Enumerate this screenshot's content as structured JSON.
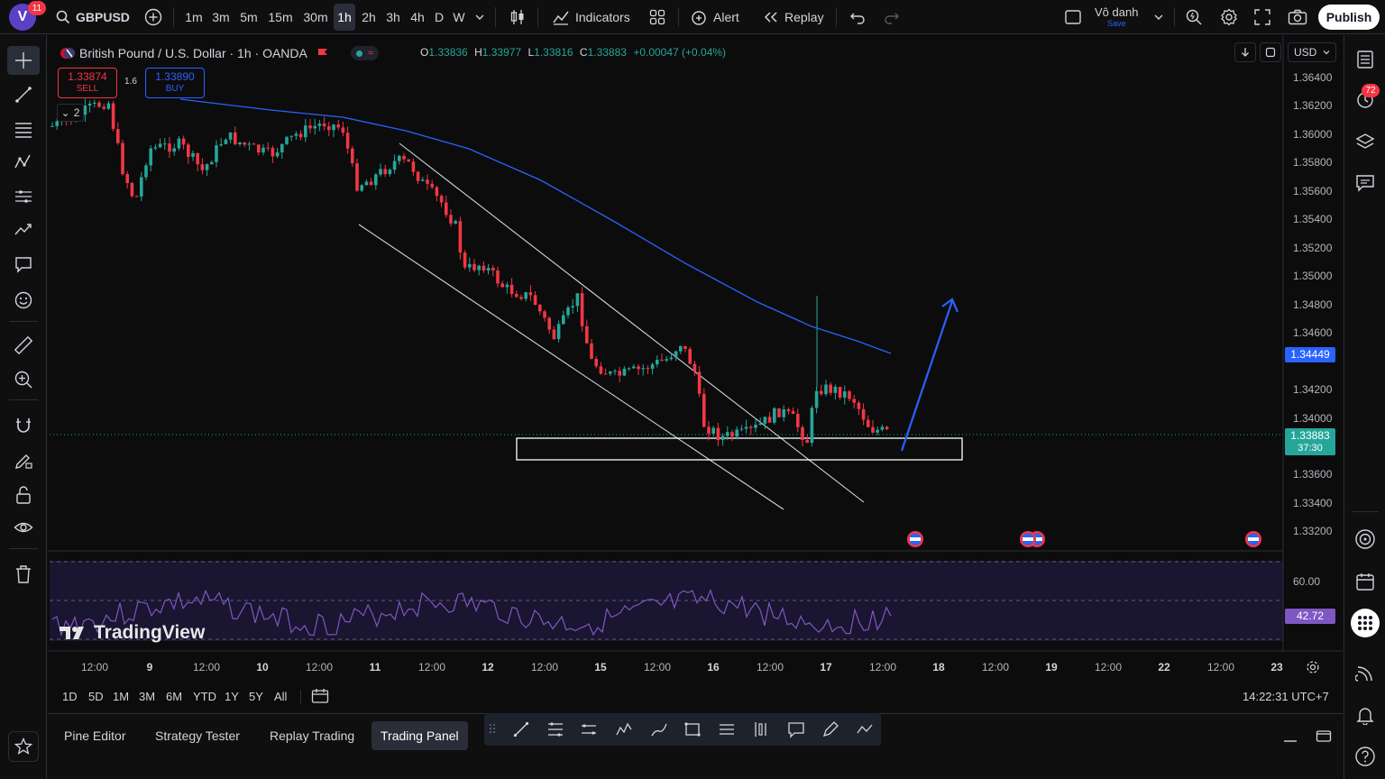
{
  "header": {
    "avatar_letter": "V",
    "avatar_badge": "11",
    "symbol": "GBPUSD",
    "timeframes": [
      {
        "label": "1m",
        "active": false
      },
      {
        "label": "3m",
        "active": false
      },
      {
        "label": "5m",
        "active": false
      },
      {
        "label": "15m",
        "active": false
      },
      {
        "label": "30m",
        "active": false
      },
      {
        "label": "1h",
        "active": true
      },
      {
        "label": "2h",
        "active": false
      },
      {
        "label": "3h",
        "active": false
      },
      {
        "label": "4h",
        "active": false
      },
      {
        "label": "D",
        "active": false
      },
      {
        "label": "W",
        "active": false
      }
    ],
    "indicators_label": "Indicators",
    "alert_label": "Alert",
    "replay_label": "Replay",
    "layout_name": "Vô danh",
    "layout_status": "Save",
    "publish_label": "Publish"
  },
  "legend": {
    "title": "British Pound / U.S. Dollar · 1h · OANDA",
    "ohlc": {
      "o": "1.33836",
      "h": "1.33977",
      "l": "1.33816",
      "c": "1.33883",
      "change": "+0.00047 (+0.04%)"
    },
    "sell_price": "1.33874",
    "sell_label": "SELL",
    "buy_price": "1.33890",
    "buy_label": "BUY",
    "spread": "1.6",
    "collapsed_count": "2"
  },
  "price_axis": {
    "currency": "USD",
    "ticks": [
      "1.36400",
      "1.36200",
      "1.36000",
      "1.35800",
      "1.35600",
      "1.35400",
      "1.35200",
      "1.35000",
      "1.34800",
      "1.34600",
      "1.34200",
      "1.34000",
      "1.33600",
      "1.33400",
      "1.33200"
    ],
    "ma_label": "1.34449",
    "last_price": "1.33883",
    "countdown": "37:30",
    "rsi_level": "60.00",
    "rsi_value": "42.72"
  },
  "time_axis": {
    "ticks": [
      {
        "label": "12:00",
        "bold": false
      },
      {
        "label": "9",
        "bold": true
      },
      {
        "label": "12:00",
        "bold": false
      },
      {
        "label": "10",
        "bold": true
      },
      {
        "label": "12:00",
        "bold": false
      },
      {
        "label": "11",
        "bold": true
      },
      {
        "label": "12:00",
        "bold": false
      },
      {
        "label": "12",
        "bold": true
      },
      {
        "label": "12:00",
        "bold": false
      },
      {
        "label": "15",
        "bold": true
      },
      {
        "label": "12:00",
        "bold": false
      },
      {
        "label": "16",
        "bold": true
      },
      {
        "label": "12:00",
        "bold": false
      },
      {
        "label": "17",
        "bold": true
      },
      {
        "label": "12:00",
        "bold": false
      },
      {
        "label": "18",
        "bold": true
      },
      {
        "label": "12:00",
        "bold": false
      },
      {
        "label": "19",
        "bold": true
      },
      {
        "label": "12:00",
        "bold": false
      },
      {
        "label": "22",
        "bold": true
      },
      {
        "label": "12:00",
        "bold": false
      },
      {
        "label": "23",
        "bold": true
      }
    ]
  },
  "watermark": "TradingView",
  "ranges": [
    "1D",
    "5D",
    "1M",
    "3M",
    "6M",
    "YTD",
    "1Y",
    "5Y",
    "All"
  ],
  "clock": "14:22:31 UTC+7",
  "bottom_tabs": [
    {
      "label": "Pine Editor",
      "active": false
    },
    {
      "label": "Strategy Tester",
      "active": false
    },
    {
      "label": "Replay Trading",
      "active": false
    },
    {
      "label": "Trading Panel",
      "active": true
    }
  ],
  "right_badge": "72",
  "colors": {
    "up": "#26a69a",
    "down": "#f23645",
    "ma": "#2962ff",
    "rsi": "#7e57c2",
    "accent": "#2962ff"
  }
}
